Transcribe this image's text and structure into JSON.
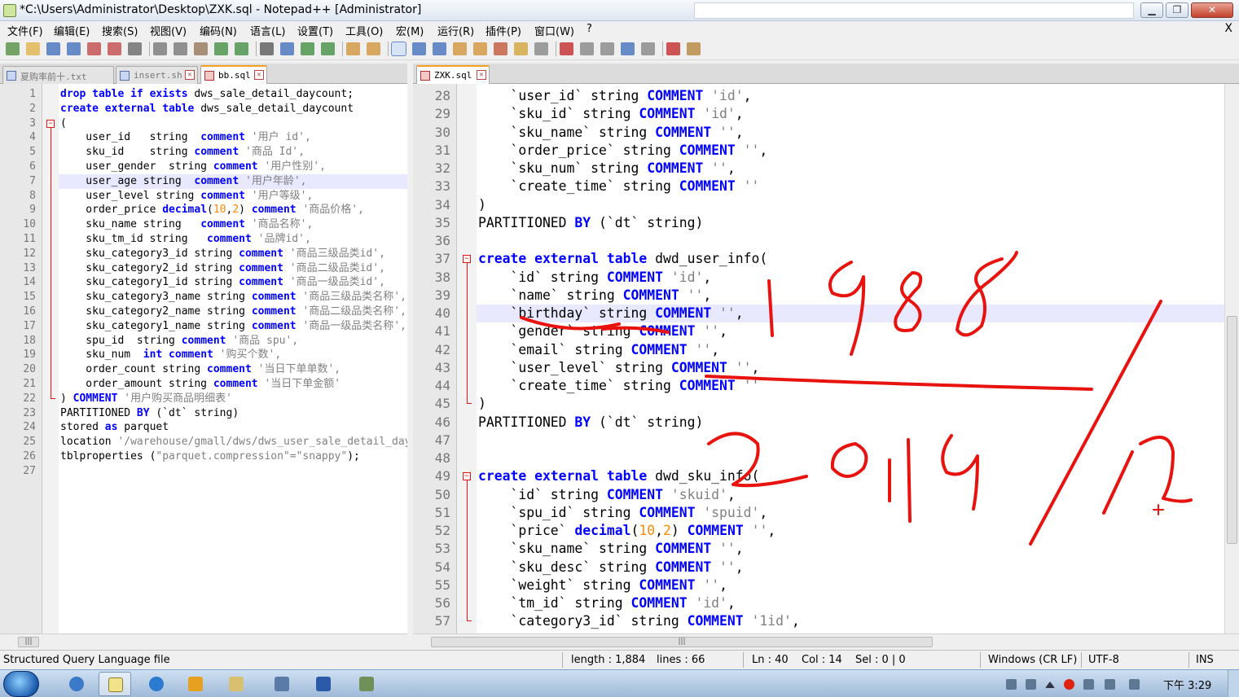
{
  "window": {
    "title": "*C:\\Users\\Administrator\\Desktop\\ZXK.sql - Notepad++ [Administrator]",
    "min_label": "▁",
    "max_label": "❐",
    "close_label": "✕"
  },
  "menu": {
    "items": [
      "文件(F)",
      "编辑(E)",
      "搜索(S)",
      "视图(V)",
      "编码(N)",
      "语言(L)",
      "设置(T)",
      "工具(O)",
      "宏(M)",
      "运行(R)",
      "插件(P)",
      "窗口(W)",
      "?"
    ],
    "close_label": "X"
  },
  "toolbar": {
    "icons": [
      "new-file-icon",
      "open-file-icon",
      "save-icon",
      "save-all-icon",
      "close-icon",
      "close-all-icon",
      "print-icon",
      "cut-icon",
      "copy-icon",
      "paste-icon",
      "undo-icon",
      "redo-icon",
      "find-icon",
      "replace-icon",
      "zoom-in-icon",
      "zoom-out-icon",
      "sync-v-icon",
      "sync-h-icon",
      "word-wrap-icon",
      "show-all-chars-icon",
      "indent-guide-icon",
      "user-lang-icon",
      "doc-map-icon",
      "function-list-icon",
      "folder-workspace-icon",
      "monitoring-icon",
      "macro-record-icon",
      "macro-stop-icon",
      "macro-play-icon",
      "macro-run-multiple-icon",
      "macro-save-icon",
      "spell-check-icon",
      "nppexec-icon"
    ]
  },
  "left_pane": {
    "tabs": [
      {
        "label": "夏购率前十.txt",
        "active": false
      },
      {
        "label": "insert.sh",
        "active": false
      },
      {
        "label": "bb.sql",
        "active": true
      }
    ],
    "first_line": 1,
    "current_line": 7,
    "lines": [
      [
        [
          "kw",
          "drop table if exists "
        ],
        [
          "",
          "dws_sale_detail_daycount;"
        ]
      ],
      [
        [
          "kw",
          "create external table "
        ],
        [
          "",
          "dws_sale_detail_daycount"
        ]
      ],
      [
        [
          "",
          "("
        ]
      ],
      [
        [
          "",
          "    user_id   string  "
        ],
        [
          "cm",
          "comment"
        ],
        [
          "str",
          " '用户 id',"
        ]
      ],
      [
        [
          "",
          "    sku_id    string "
        ],
        [
          "cm",
          "comment"
        ],
        [
          "str",
          " '商品 Id',"
        ]
      ],
      [
        [
          "",
          "    user_gender  string "
        ],
        [
          "cm",
          "comment"
        ],
        [
          "str",
          " '用户性别',"
        ]
      ],
      [
        [
          "",
          "    user_age string  "
        ],
        [
          "cm",
          "comment"
        ],
        [
          "str",
          " '用户年龄',"
        ]
      ],
      [
        [
          "",
          "    user_level string "
        ],
        [
          "cm",
          "comment"
        ],
        [
          "str",
          " '用户等级',"
        ]
      ],
      [
        [
          "",
          "    order_price "
        ],
        [
          "kw",
          "decimal"
        ],
        [
          "",
          "("
        ],
        [
          "num",
          "10"
        ],
        [
          "",
          ","
        ],
        [
          "num",
          "2"
        ],
        [
          "",
          ") "
        ],
        [
          "cm",
          "comment"
        ],
        [
          "str",
          " '商品价格',"
        ]
      ],
      [
        [
          "",
          "    sku_name string   "
        ],
        [
          "cm",
          "comment"
        ],
        [
          "str",
          " '商品名称',"
        ]
      ],
      [
        [
          "",
          "    sku_tm_id string   "
        ],
        [
          "cm",
          "comment"
        ],
        [
          "str",
          " '品牌id',"
        ]
      ],
      [
        [
          "",
          "    sku_category3_id string "
        ],
        [
          "cm",
          "comment"
        ],
        [
          "str",
          " '商品三级品类id',"
        ]
      ],
      [
        [
          "",
          "    sku_category2_id string "
        ],
        [
          "cm",
          "comment"
        ],
        [
          "str",
          " '商品二级品类id',"
        ]
      ],
      [
        [
          "",
          "    sku_category1_id string "
        ],
        [
          "cm",
          "comment"
        ],
        [
          "str",
          " '商品一级品类id',"
        ]
      ],
      [
        [
          "",
          "    sku_category3_name string "
        ],
        [
          "cm",
          "comment"
        ],
        [
          "str",
          " '商品三级品类名称',"
        ]
      ],
      [
        [
          "",
          "    sku_category2_name string "
        ],
        [
          "cm",
          "comment"
        ],
        [
          "str",
          " '商品二级品类名称',"
        ]
      ],
      [
        [
          "",
          "    sku_category1_name string "
        ],
        [
          "cm",
          "comment"
        ],
        [
          "str",
          " '商品一级品类名称',"
        ]
      ],
      [
        [
          "",
          "    spu_id  string "
        ],
        [
          "cm",
          "comment"
        ],
        [
          "str",
          " '商品 spu',"
        ]
      ],
      [
        [
          "",
          "    sku_num  "
        ],
        [
          "kw",
          "int"
        ],
        [
          "",
          ""
        ],
        [
          "cm",
          " comment"
        ],
        [
          "str",
          " '购买个数',"
        ]
      ],
      [
        [
          "",
          "    order_count string "
        ],
        [
          "cm",
          "comment"
        ],
        [
          "str",
          " '当日下单单数',"
        ]
      ],
      [
        [
          "",
          "    order_amount string "
        ],
        [
          "cm",
          "comment"
        ],
        [
          "str",
          " '当日下单金额'"
        ]
      ],
      [
        [
          "",
          ") "
        ],
        [
          "cm",
          "COMMENT"
        ],
        [
          "str",
          " '用户购买商品明细表'"
        ]
      ],
      [
        [
          "",
          "PARTITIONED "
        ],
        [
          "kw",
          "BY"
        ],
        [
          "",
          " (`dt` string)"
        ]
      ],
      [
        [
          "",
          "stored "
        ],
        [
          "kw",
          "as"
        ],
        [
          "",
          " parquet"
        ]
      ],
      [
        [
          "",
          "location "
        ],
        [
          "str",
          "'/warehouse/gmall/dws/dws_user_sale_detail_daycount/'"
        ]
      ],
      [
        [
          "",
          "tblproperties ("
        ],
        [
          "str",
          "\"parquet.compression\"=\"snappy\""
        ],
        [
          "",
          ");"
        ]
      ],
      [
        [
          "",
          ""
        ]
      ]
    ]
  },
  "right_pane": {
    "tabs": [
      {
        "label": "ZXK.sql",
        "active": true
      }
    ],
    "first_line": 28,
    "current_line": 40,
    "lines": [
      [
        [
          "",
          "    `user_id` string "
        ],
        [
          "cm",
          "COMMENT"
        ],
        [
          "str",
          " 'id'"
        ],
        [
          "",
          ","
        ]
      ],
      [
        [
          "",
          "    `sku_id` string "
        ],
        [
          "cm",
          "COMMENT"
        ],
        [
          "str",
          " 'id'"
        ],
        [
          "",
          ","
        ]
      ],
      [
        [
          "",
          "    `sku_name` string "
        ],
        [
          "cm",
          "COMMENT"
        ],
        [
          "str",
          " ''"
        ],
        [
          "",
          ","
        ]
      ],
      [
        [
          "",
          "    `order_price` string "
        ],
        [
          "cm",
          "COMMENT"
        ],
        [
          "str",
          " ''"
        ],
        [
          "",
          ","
        ]
      ],
      [
        [
          "",
          "    `sku_num` string "
        ],
        [
          "cm",
          "COMMENT"
        ],
        [
          "str",
          " ''"
        ],
        [
          "",
          ","
        ]
      ],
      [
        [
          "",
          "    `create_time` string "
        ],
        [
          "cm",
          "COMMENT"
        ],
        [
          "str",
          " ''"
        ]
      ],
      [
        [
          "",
          ")"
        ]
      ],
      [
        [
          "",
          "PARTITIONED "
        ],
        [
          "kw",
          "BY"
        ],
        [
          "",
          "",
          " (`dt` string)"
        ]
      ],
      [
        [
          "",
          ""
        ]
      ],
      [
        [
          "kw",
          "create external table "
        ],
        [
          "",
          "dwd_user_info("
        ]
      ],
      [
        [
          "",
          "    `id` string "
        ],
        [
          "cm",
          "COMMENT"
        ],
        [
          "str",
          " 'id'"
        ],
        [
          "",
          ","
        ]
      ],
      [
        [
          "",
          "    `name` string "
        ],
        [
          "cm",
          "COMMENT"
        ],
        [
          "str",
          " ''"
        ],
        [
          "",
          ","
        ]
      ],
      [
        [
          "",
          "    `birthday` string "
        ],
        [
          "cm",
          "COMMENT"
        ],
        [
          "str",
          " ''"
        ],
        [
          "",
          ","
        ]
      ],
      [
        [
          "",
          "    `gender` string "
        ],
        [
          "cm",
          "COMMENT"
        ],
        [
          "str",
          " ''"
        ],
        [
          "",
          ","
        ]
      ],
      [
        [
          "",
          "    `email` string "
        ],
        [
          "cm",
          "COMMENT"
        ],
        [
          "str",
          " ''"
        ],
        [
          "",
          ","
        ]
      ],
      [
        [
          "",
          "    `user_level` string "
        ],
        [
          "cm",
          "COMMENT"
        ],
        [
          "str",
          " ''"
        ],
        [
          "",
          ","
        ]
      ],
      [
        [
          "",
          "    `create_time` string "
        ],
        [
          "cm",
          "COMMENT"
        ],
        [
          "str",
          " ''"
        ]
      ],
      [
        [
          "",
          ")"
        ]
      ],
      [
        [
          "",
          "PARTITIONED "
        ],
        [
          "kw",
          "BY"
        ],
        [
          "",
          " (`dt` string)"
        ]
      ],
      [
        [
          "",
          ""
        ]
      ],
      [
        [
          "",
          ""
        ]
      ],
      [
        [
          "kw",
          "create external table "
        ],
        [
          "",
          "dwd_sku_info("
        ]
      ],
      [
        [
          "",
          "    `id` string "
        ],
        [
          "cm",
          "COMMENT"
        ],
        [
          "str",
          " 'skuid'"
        ],
        [
          "",
          ","
        ]
      ],
      [
        [
          "",
          "    `spu_id` string "
        ],
        [
          "cm",
          "COMMENT"
        ],
        [
          "str",
          " 'spuid'"
        ],
        [
          "",
          ","
        ]
      ],
      [
        [
          "",
          "    `price` "
        ],
        [
          "kw",
          "decimal"
        ],
        [
          "",
          "("
        ],
        [
          "num",
          "10"
        ],
        [
          "",
          ","
        ],
        [
          "num",
          "2"
        ],
        [
          "",
          ") "
        ],
        [
          "cm",
          "COMMENT"
        ],
        [
          "str",
          " ''"
        ],
        [
          "",
          ","
        ]
      ],
      [
        [
          "",
          "    `sku_name` string "
        ],
        [
          "cm",
          "COMMENT"
        ],
        [
          "str",
          " ''"
        ],
        [
          "",
          ","
        ]
      ],
      [
        [
          "",
          "    `sku_desc` string "
        ],
        [
          "cm",
          "COMMENT"
        ],
        [
          "str",
          " ''"
        ],
        [
          "",
          ","
        ]
      ],
      [
        [
          "",
          "    `weight` string "
        ],
        [
          "cm",
          "COMMENT"
        ],
        [
          "str",
          " ''"
        ],
        [
          "",
          ","
        ]
      ],
      [
        [
          "",
          "    `tm_id` string "
        ],
        [
          "cm",
          "COMMENT"
        ],
        [
          "str",
          " 'id'"
        ],
        [
          "",
          ","
        ]
      ],
      [
        [
          "",
          "    `category3_id` string "
        ],
        [
          "cm",
          "COMMENT"
        ],
        [
          "str",
          " '1id'"
        ],
        [
          "",
          ","
        ]
      ]
    ]
  },
  "statusbar": {
    "filetype": "Structured Query Language file",
    "length": "length : 1,884",
    "lines": "lines : 66",
    "ln": "Ln : 40",
    "col": "Col : 14",
    "sel": "Sel : 0 | 0",
    "eol": "Windows (CR LF)",
    "encoding": "UTF-8",
    "mode": "INS"
  },
  "taskbar": {
    "apps": [
      "ie-icon",
      "notepad-icon",
      "chrome-icon",
      "explorer-icon",
      "folder-icon",
      "remote-desktop-icon",
      "word-icon",
      "tool-icon"
    ],
    "clock": "下午 3:29"
  },
  "handwriting": {
    "color": "#e8130e",
    "text": "1988 / 2019/12"
  }
}
